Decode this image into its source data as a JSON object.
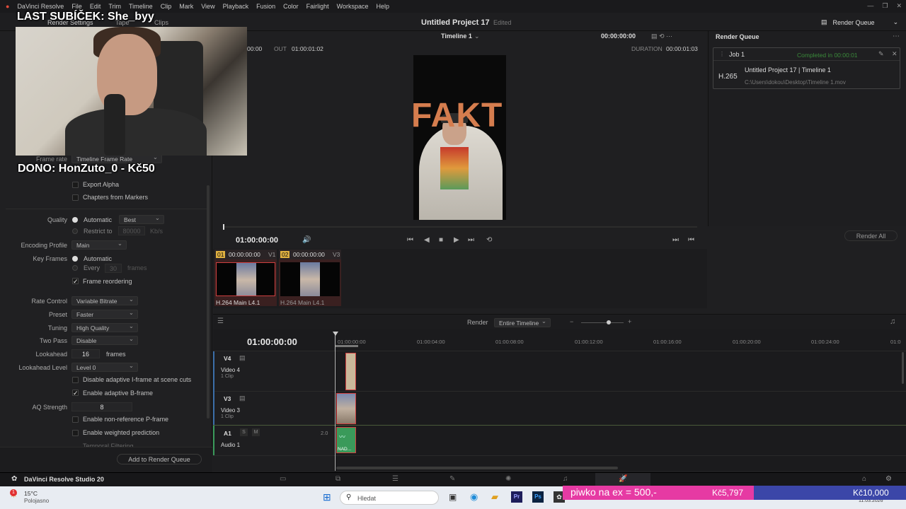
{
  "menubar": {
    "app": "DaVinci Resolve",
    "items": [
      "File",
      "Edit",
      "Trim",
      "Timeline",
      "Clip",
      "Mark",
      "View",
      "Playback",
      "Fusion",
      "Color",
      "Fairlight",
      "Workspace",
      "Help"
    ]
  },
  "topbar": {
    "render_settings": "Render Settings",
    "tape": "Tape",
    "clips": "Clips",
    "project_title": "Untitled Project 17",
    "project_status": "Edited",
    "render_queue_label": "Render Queue"
  },
  "overlay": {
    "last_sub": "LAST SUBÍČEK: She_byy",
    "dono": "DONO: HonZuto_0 - Kč50"
  },
  "left_panel": {
    "frame_rate_label": "Frame rate",
    "frame_rate_value": "Timeline Frame Rate",
    "export_alpha": "Export Alpha",
    "chapters": "Chapters from Markers",
    "quality_label": "Quality",
    "quality_auto": "Automatic",
    "quality_best": "Best",
    "restrict_to": "Restrict to",
    "restrict_value": "80000",
    "restrict_unit": "Kb/s",
    "encoding_profile_label": "Encoding Profile",
    "encoding_profile_value": "Main",
    "key_frames_label": "Key Frames",
    "key_frames_auto": "Automatic",
    "key_frames_every": "Every",
    "key_frames_every_value": "30",
    "key_frames_unit": "frames",
    "frame_reordering": "Frame reordering",
    "rate_control_label": "Rate Control",
    "rate_control_value": "Variable Bitrate",
    "preset_label": "Preset",
    "preset_value": "Faster",
    "tuning_label": "Tuning",
    "tuning_value": "High Quality",
    "two_pass_label": "Two Pass",
    "two_pass_value": "Disable",
    "lookahead_label": "Lookahead",
    "lookahead_value": "16",
    "lookahead_unit": "frames",
    "lookahead_level_label": "Lookahead Level",
    "lookahead_level_value": "Level 0",
    "disable_adaptive_i": "Disable adaptive I-frame at scene cuts",
    "enable_adaptive_b": "Enable adaptive B-frame",
    "aq_strength_label": "AQ Strength",
    "aq_strength_value": "8",
    "enable_non_ref": "Enable non-reference P-frame",
    "enable_weighted": "Enable weighted prediction",
    "temporal_filtering": "Temporal Filtering",
    "add_to_queue": "Add to Render Queue"
  },
  "viewer": {
    "timeline_name": "Timeline 1",
    "top_tc": "00:00:00:00",
    "in_tc": "00:00",
    "out_label": "OUT",
    "out_tc": "01:00:01:02",
    "duration_label": "DURATION",
    "duration_tc": "00:00:01:03",
    "overlay_text": "FAKT",
    "playback_tc": "01:00:00:00"
  },
  "clips": [
    {
      "num": "01",
      "tc": "00:00:00:00",
      "track": "V1",
      "codec": "H.264 Main L4.1"
    },
    {
      "num": "02",
      "tc": "00:00:00:00",
      "track": "V3",
      "codec": "H.264 Main L4.1"
    }
  ],
  "render_queue": {
    "title": "Render Queue",
    "job_name": "Job 1",
    "job_status": "Completed in 00:00:01",
    "job_codec": "H.265",
    "job_title": "Untitled Project 17 | Timeline 1",
    "job_path": "C:\\Users\\dokou\\Desktop\\Timeline 1.mov",
    "render_all": "Render All"
  },
  "timeline": {
    "render_label": "Render",
    "render_value": "Entire Timeline",
    "timecode": "01:00:00:00",
    "ruler": [
      "01:00:00:00",
      "01:00:04:00",
      "01:00:08:00",
      "01:00:12:00",
      "01:00:16:00",
      "01:00:20:00",
      "01:00:24:00",
      "01:0"
    ],
    "tracks": [
      {
        "id": "V4",
        "name": "Video 4",
        "clips": "1 Clip"
      },
      {
        "id": "V3",
        "name": "Video 3",
        "clips": "1 Clip"
      },
      {
        "id": "A1",
        "name": "Audio 1",
        "level": "2.0"
      }
    ],
    "audio_clip_label": "NAD..."
  },
  "pagebar": {
    "app_name": "DaVinci Resolve Studio 20"
  },
  "taskbar": {
    "temp": "15°C",
    "weather": "Polojasno",
    "search_placeholder": "Hledat",
    "date": "11.03.2026"
  },
  "donation_bars": {
    "left_text": "piwko na ex = 500,-",
    "left_amount": "Kč5,797",
    "right_amount": "Kč10,000",
    "progress": 0.58
  }
}
